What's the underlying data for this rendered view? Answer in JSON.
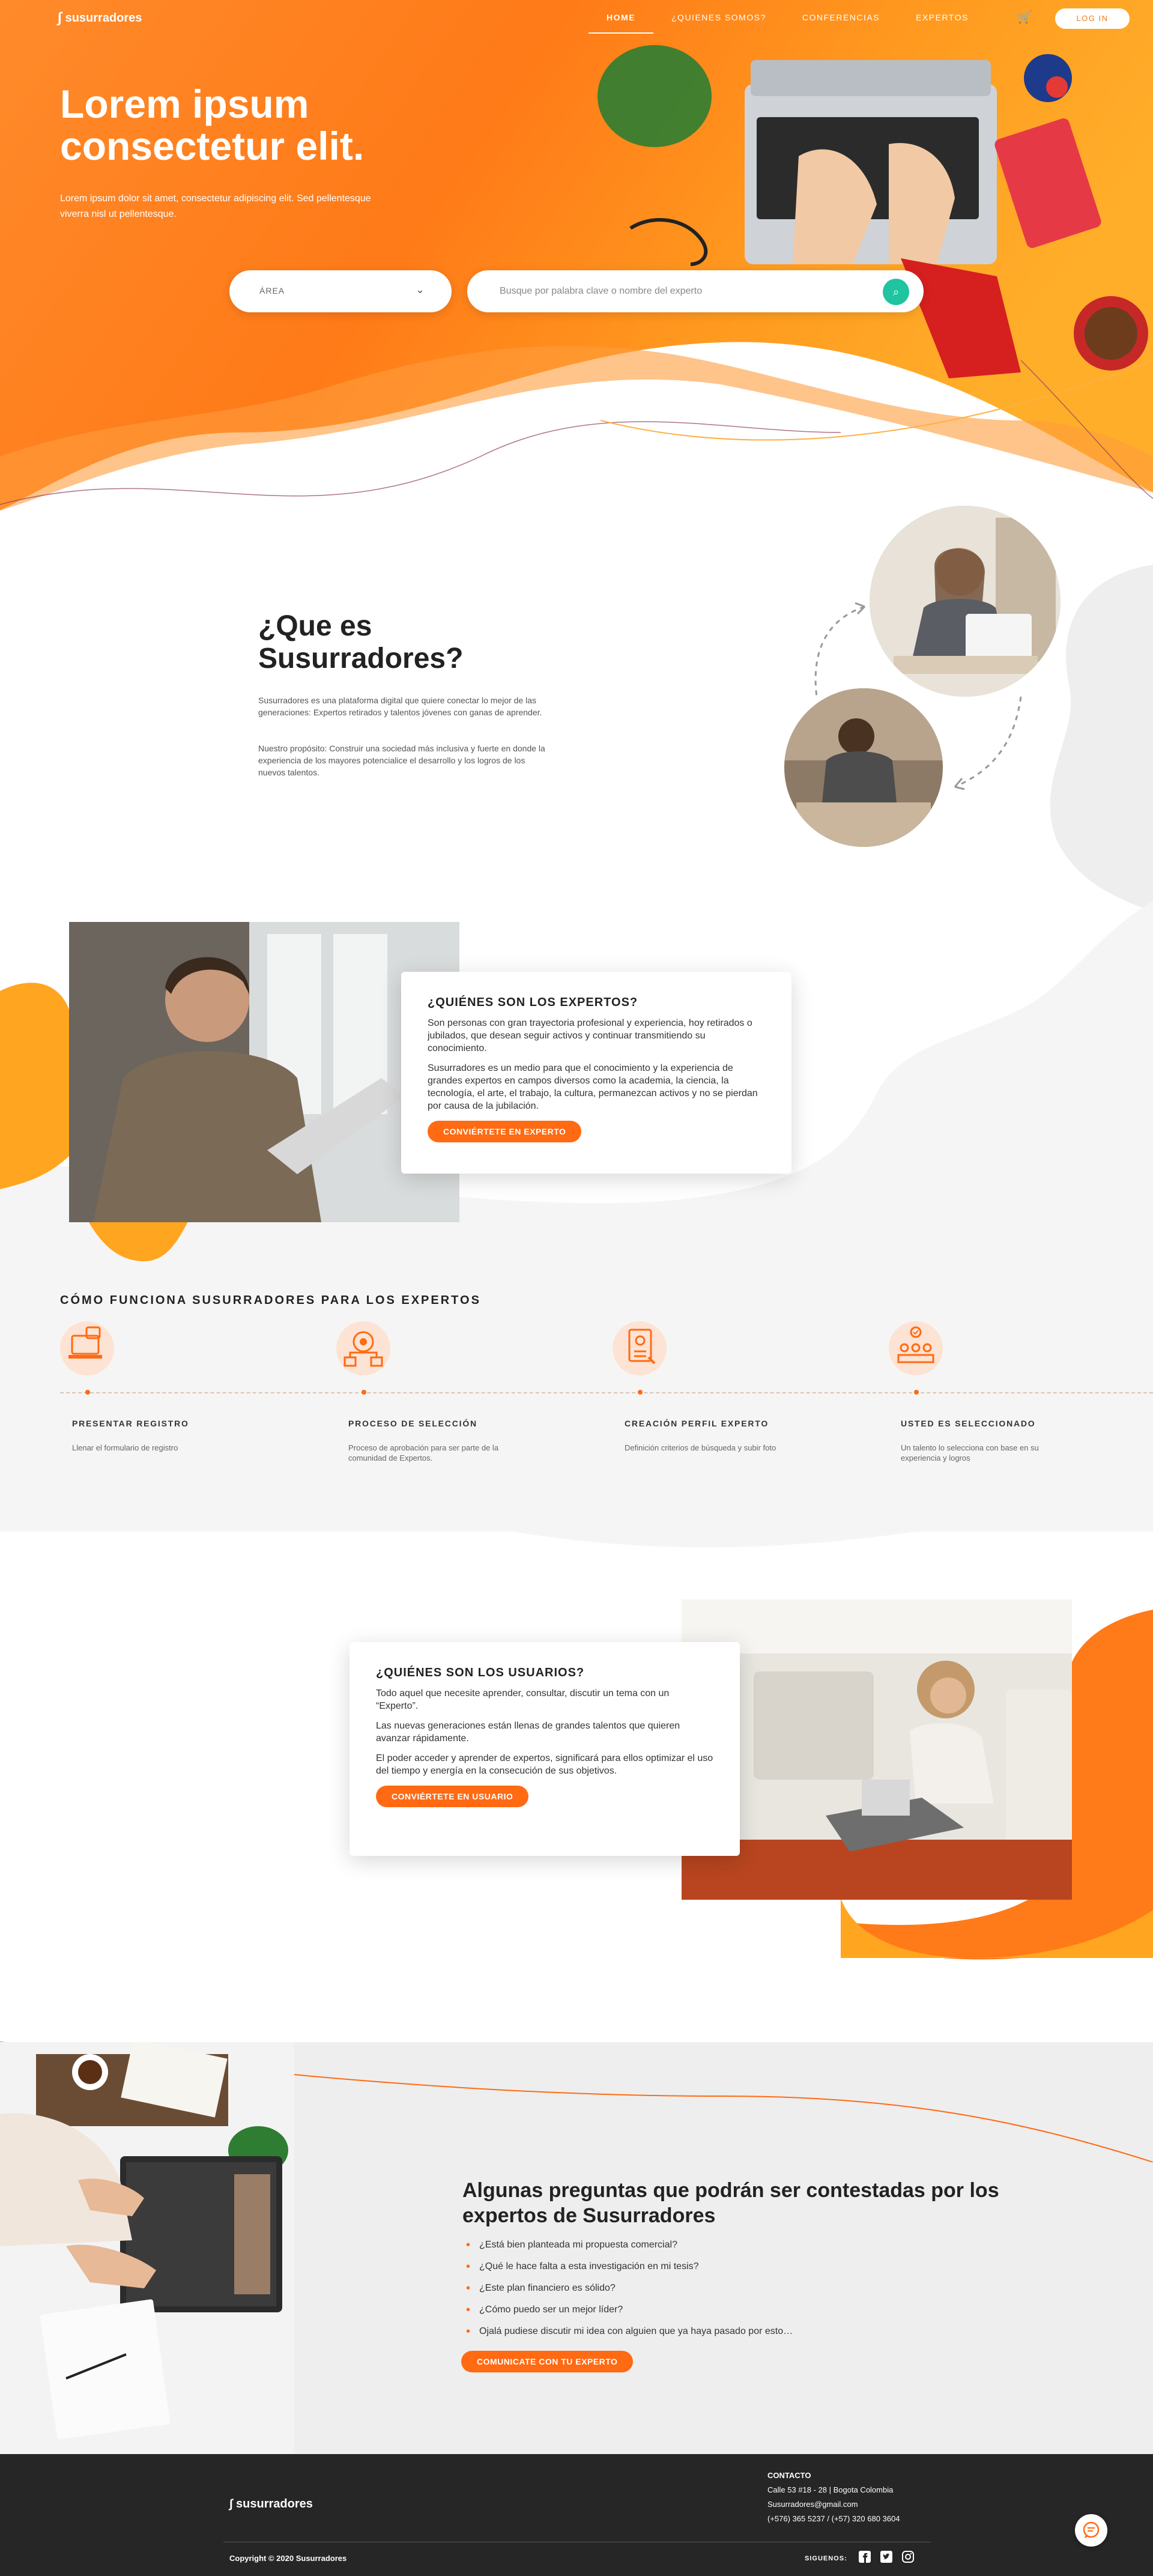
{
  "nav": {
    "brand": "susurradores",
    "items": [
      {
        "label": "HOME",
        "active": true
      },
      {
        "label": "¿QUIENES SOMOS?",
        "active": false
      },
      {
        "label": "CONFERENCIAS",
        "active": false
      },
      {
        "label": "EXPERTOS",
        "active": false
      }
    ],
    "cart_icon": "cart-icon",
    "login_label": "LOG IN"
  },
  "hero": {
    "title": "Lorem ipsum consectetur elit.",
    "subtitle": "Lorem ipsum dolor sit amet, consectetur adipiscing elit. Sed pellentesque viverra nisl ut pellentesque.",
    "area_select": "ÁREA",
    "search_placeholder": "Busque por palabra clave o nombre del experto"
  },
  "about": {
    "title": "¿Que es Susurradores?",
    "p1": "Susurradores es una plataforma digital que quiere conectar lo mejor de las generaciones: Expertos retirados y talentos jóvenes con ganas de aprender.",
    "p2": "Nuestro propósito: Construir una sociedad más inclusiva y fuerte en donde la experiencia de los mayores potencialice el desarrollo y los logros de los nuevos talentos."
  },
  "experts": {
    "title": "¿QUIÉNES SON LOS EXPERTOS?",
    "p1": "Son personas con gran trayectoria profesional y experiencia, hoy retirados o jubilados, que desean seguir activos y continuar transmitiendo su conocimiento.",
    "p2": "Susurradores es un medio para que el conocimiento y la experiencia de grandes expertos en campos diversos como la academia, la ciencia, la tecnología, el arte, el trabajo, la cultura, permanezcan activos y no se pierdan por causa de la jubilación.",
    "button": "CONVIÉRTETE EN EXPERTO"
  },
  "how": {
    "title": "CÓMO FUNCIONA SUSURRADORES PARA LOS EXPERTOS",
    "steps": [
      {
        "title": "PRESENTAR REGISTRO",
        "desc": "Llenar el formulario de registro",
        "icon": "laptop-lock-icon"
      },
      {
        "title": "PROCESO DE SELECCIÓN",
        "desc": "Proceso de aprobación para ser parte de la comunidad de Expertos.",
        "icon": "gears-network-icon"
      },
      {
        "title": "CREACIÓN PERFIL EXPERTO",
        "desc": "Definición criterios de búsqueda y subir foto",
        "icon": "profile-document-icon"
      },
      {
        "title": "USTED ES SELECCIONADO",
        "desc": "Un talento lo selecciona con base en su experiencia y logros",
        "icon": "selected-people-icon"
      }
    ]
  },
  "users": {
    "title": "¿QUIÉNES SON LOS USUARIOS?",
    "p1": "Todo aquel que necesite aprender, consultar, discutir un tema con un “Experto”.",
    "p2": "Las nuevas generaciones están llenas de grandes talentos que quieren avanzar rápidamente.",
    "p3": "El poder acceder y aprender de expertos, significará para ellos optimizar el uso del tiempo y energía en la consecución de sus objetivos.",
    "button": "CONVIÉRTETE EN USUARIO"
  },
  "faq": {
    "title": "Algunas preguntas que podrán ser contestadas por los expertos de Susurradores",
    "items": [
      "¿Está bien planteada mi propuesta comercial?",
      "¿Qué le hace falta a esta investigación en mi tesis?",
      "¿Este plan financiero es sólido?",
      "¿Cómo puedo ser un mejor líder?",
      "Ojalá pudiese discutir mi idea con alguien que ya haya pasado por esto…"
    ],
    "button": "COMUNICATE CON TU EXPERTO"
  },
  "footer": {
    "brand": "susurradores",
    "contact_heading": "CONTACTO",
    "address": "Calle 53 #18 - 28 | Bogota Colombia",
    "email": "Susurradores@gmail.com",
    "phone": "(+576) 365 5237 / (+57) 320 680 3604",
    "copyright": "Copyright © 2020 Susurradores",
    "follow": "SIGUENOS:",
    "social": [
      "facebook-icon",
      "twitter-icon",
      "instagram-icon"
    ]
  },
  "colors": {
    "orange": "#ff6a13",
    "orange_light": "#ffa51f",
    "teal": "#20c4a0",
    "dark": "#262626",
    "gray_bg": "#f5f5f5"
  }
}
